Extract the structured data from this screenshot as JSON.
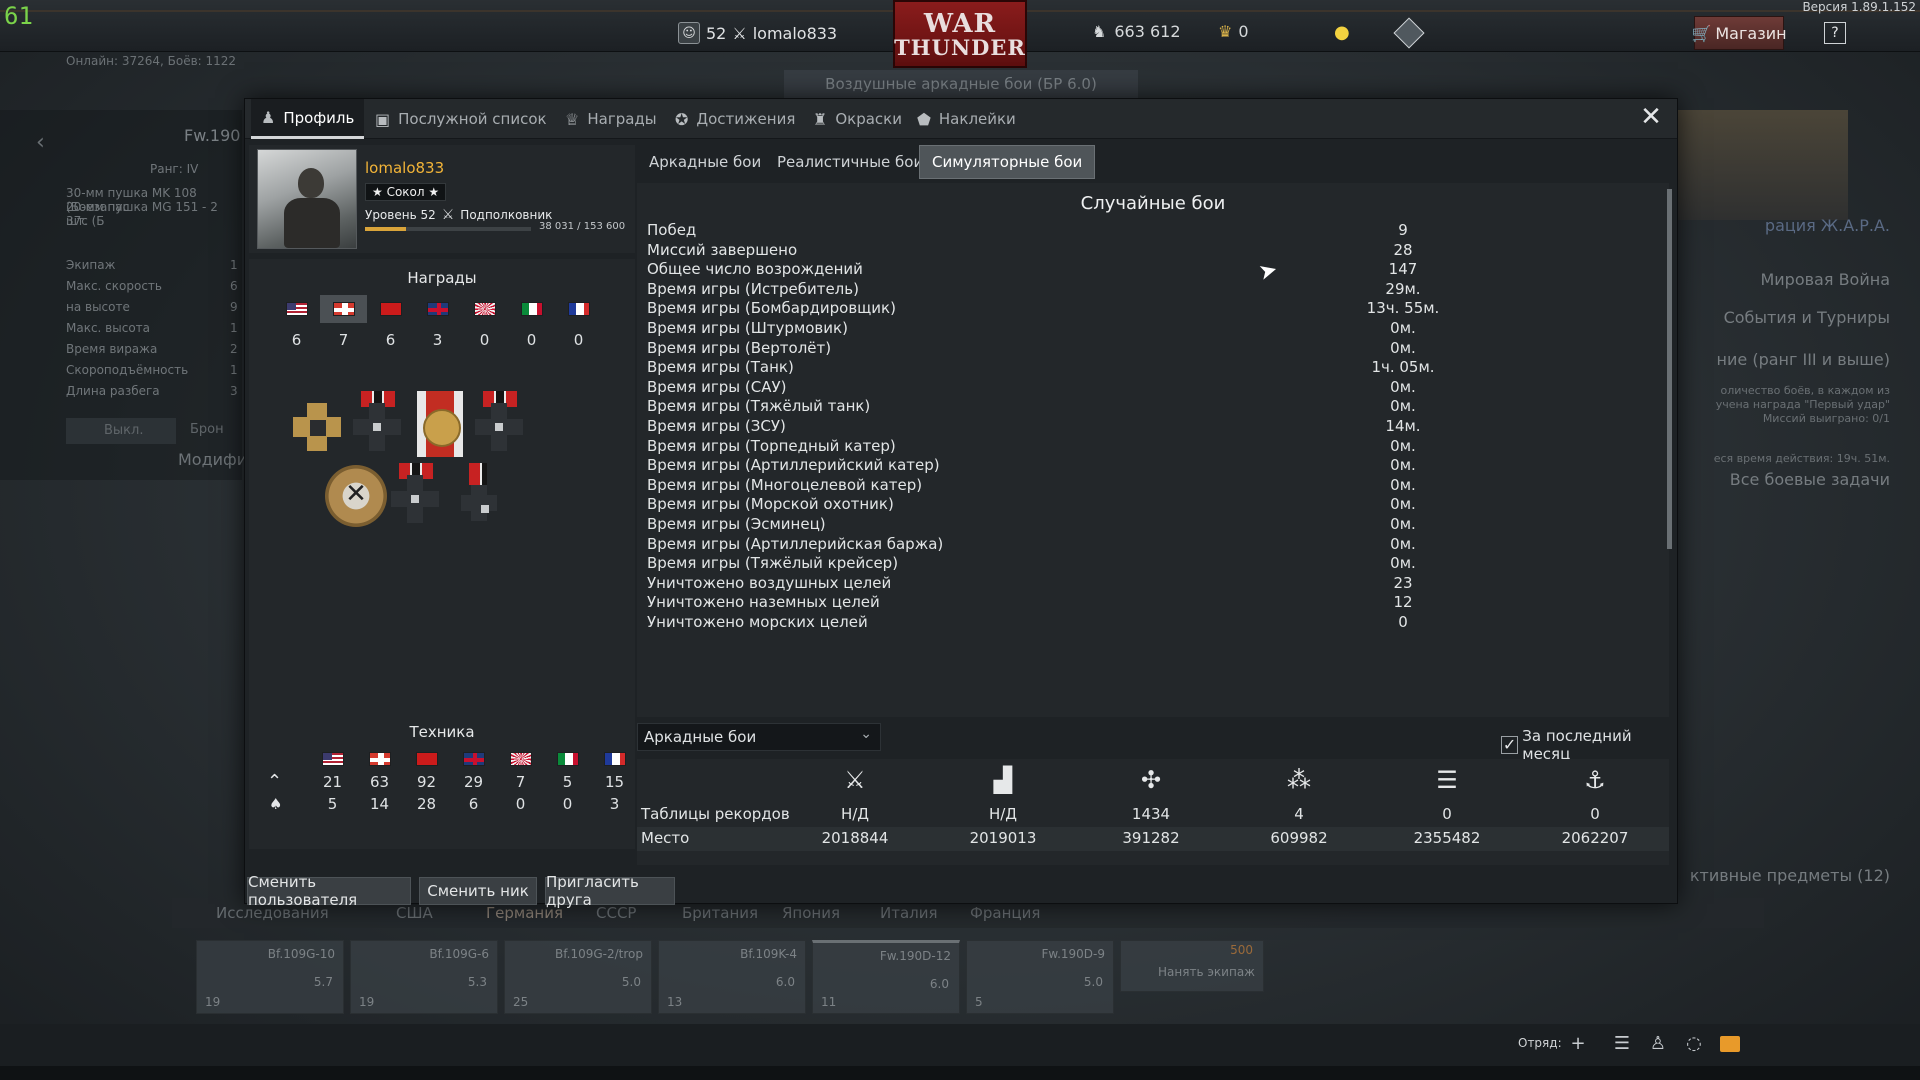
{
  "topbar": {
    "fps": "61",
    "version": "Версия 1.89.1.152",
    "user_level": "52",
    "username": "lomalo833",
    "logo_line1": "WAR",
    "logo_line2": "THUNDER",
    "silver_lions": "663 612",
    "golden_eagles": "0",
    "shop_label": "Магазин",
    "help_label": "?"
  },
  "background": {
    "online": "Онлайн: 37264, Боёв: 1122",
    "mode_bar": "Воздушные аркадные бои (БР 6.0)",
    "vehicle_name": "Fw.190",
    "rank": "Ранг: IV",
    "weapons": [
      "30-мм пушка MK 108 (Боезапас",
      "20-мм пушка MG 151 - 2 шт. (Б",
      "37с"
    ],
    "specs": [
      "Экипаж",
      "Макс. скорость",
      "на высоте",
      "Макс. высота",
      "Время виража",
      "Скороподъёмность",
      "Длина разбега"
    ],
    "spec_vals": [
      "1",
      "6",
      "9",
      "1",
      "2",
      "1",
      "3"
    ],
    "off_label": "Выкл.",
    "armor_label": "Брон",
    "modif_label": "Модифи",
    "right_items": [
      "рация Ж.А.Р.А.",
      "Мировая Война",
      "События и Турниры",
      "ние (ранг III и выше)",
      "Все боевые задачи",
      "ктивные предметы (12)"
    ],
    "right_notes": [
      "оличество боёв, в каждом из",
      "учена награда \"Первый удар\"",
      "Миссий выиграно: 0/1",
      "еся время действия: 19ч. 51м."
    ],
    "research_tab": "Исследования",
    "nation_tabs": [
      "США",
      "Германия",
      "СССР",
      "Британия",
      "Япония",
      "Италия",
      "Франция"
    ],
    "cards": [
      {
        "name": "Bf.109G-10",
        "rank": "5.7",
        "count": "19"
      },
      {
        "name": "Bf.109G-6",
        "rank": "5.3",
        "count": "19"
      },
      {
        "name": "Bf.109G-2/trop",
        "rank": "5.0",
        "count": "25"
      },
      {
        "name": "Bf.109K-4",
        "rank": "6.0",
        "count": "13"
      },
      {
        "name": "Fw.190D-12",
        "rank": "6.0",
        "count": "11"
      },
      {
        "name": "Fw.190D-9",
        "rank": "5.0",
        "count": "5"
      },
      {
        "name": "Нанять экипаж",
        "rank": "500",
        "count": ""
      }
    ],
    "squad_label": "Отряд:"
  },
  "window": {
    "tabs": [
      {
        "label": "Профиль",
        "icon": "soldier-icon"
      },
      {
        "label": "Послужной список",
        "icon": "service-record-icon"
      },
      {
        "label": "Награды",
        "icon": "award-icon"
      },
      {
        "label": "Достижения",
        "icon": "achievement-icon"
      },
      {
        "label": "Окраски",
        "icon": "paint-icon"
      },
      {
        "label": "Наклейки",
        "icon": "decal-icon"
      }
    ],
    "close": "✕"
  },
  "profile": {
    "nick": "lomalo833",
    "title": "★ Сокол ★",
    "level_label": "Уровень 52",
    "rank_title": "Подполковник",
    "xp_text": "38 031 / 153 600",
    "xp_fraction": 0.2476
  },
  "awards": {
    "header": "Награды",
    "nations": [
      {
        "name": "usa",
        "count": "6"
      },
      {
        "name": "germany",
        "count": "7"
      },
      {
        "name": "ussr",
        "count": "6"
      },
      {
        "name": "britain",
        "count": "3"
      },
      {
        "name": "japan",
        "count": "0"
      },
      {
        "name": "italy",
        "count": "0"
      },
      {
        "name": "france",
        "count": "0"
      }
    ],
    "selected_nation": "germany"
  },
  "tech": {
    "header": "Техника",
    "row1": [
      "21",
      "63",
      "92",
      "29",
      "7",
      "5",
      "15"
    ],
    "row2": [
      "5",
      "14",
      "28",
      "6",
      "0",
      "0",
      "3"
    ]
  },
  "buttons": {
    "change_user": "Сменить пользователя",
    "change_nick": "Сменить ник",
    "invite": "Пригласить друга"
  },
  "modes": {
    "tabs": [
      "Аркадные бои",
      "Реалистичные бои",
      "Симуляторные бои"
    ],
    "active": 2
  },
  "stats": {
    "header": "Случайные бои",
    "rows": [
      {
        "label": "Побед",
        "value": "9"
      },
      {
        "label": "Миссий завершено",
        "value": "28"
      },
      {
        "label": "Общее число возрождений",
        "value": "147"
      },
      {
        "label": "Время игры (Истребитель)",
        "value": "29м."
      },
      {
        "label": "Время игры (Бомбардировщик)",
        "value": "13ч. 55м."
      },
      {
        "label": "Время игры (Штурмовик)",
        "value": "0м."
      },
      {
        "label": "Время игры (Вертолёт)",
        "value": "0м."
      },
      {
        "label": "Время игры (Танк)",
        "value": "1ч. 05м."
      },
      {
        "label": "Время игры (САУ)",
        "value": "0м."
      },
      {
        "label": "Время игры (Тяжёлый танк)",
        "value": "0м."
      },
      {
        "label": "Время игры (ЗСУ)",
        "value": "14м."
      },
      {
        "label": "Время игры (Торпедный катер)",
        "value": "0м."
      },
      {
        "label": "Время игры (Артиллерийский катер)",
        "value": "0м."
      },
      {
        "label": "Время игры (Многоцелевой катер)",
        "value": "0м."
      },
      {
        "label": "Время игры (Морской охотник)",
        "value": "0м."
      },
      {
        "label": "Время игры (Эсминец)",
        "value": "0м."
      },
      {
        "label": "Время игры (Артиллерийская баржа)",
        "value": "0м."
      },
      {
        "label": "Время игры (Тяжёлый крейсер)",
        "value": "0м."
      },
      {
        "label": "Уничтожено воздушных целей",
        "value": "23"
      },
      {
        "label": "Уничтожено наземных целей",
        "value": "12"
      },
      {
        "label": "Уничтожено морских целей",
        "value": "0"
      }
    ]
  },
  "leaderboard": {
    "mode_select": "Аркадные бои",
    "last_month_label": "За последний месяц",
    "last_month_checked": true,
    "row_labels": [
      "Таблицы рекордов",
      "Место"
    ],
    "columns": [
      {
        "icon": "crossed-swords-icon",
        "value": "Н/Д",
        "place": "2018844"
      },
      {
        "icon": "podium-icon",
        "value": "Н/Д",
        "place": "2019013"
      },
      {
        "icon": "emblem-icon",
        "value": "1434",
        "place": "391282"
      },
      {
        "icon": "stars-icon",
        "value": "4",
        "place": "609982"
      },
      {
        "icon": "ground-targets-icon",
        "value": "0",
        "place": "2355482"
      },
      {
        "icon": "naval-targets-icon",
        "value": "0",
        "place": "2062207"
      }
    ]
  }
}
